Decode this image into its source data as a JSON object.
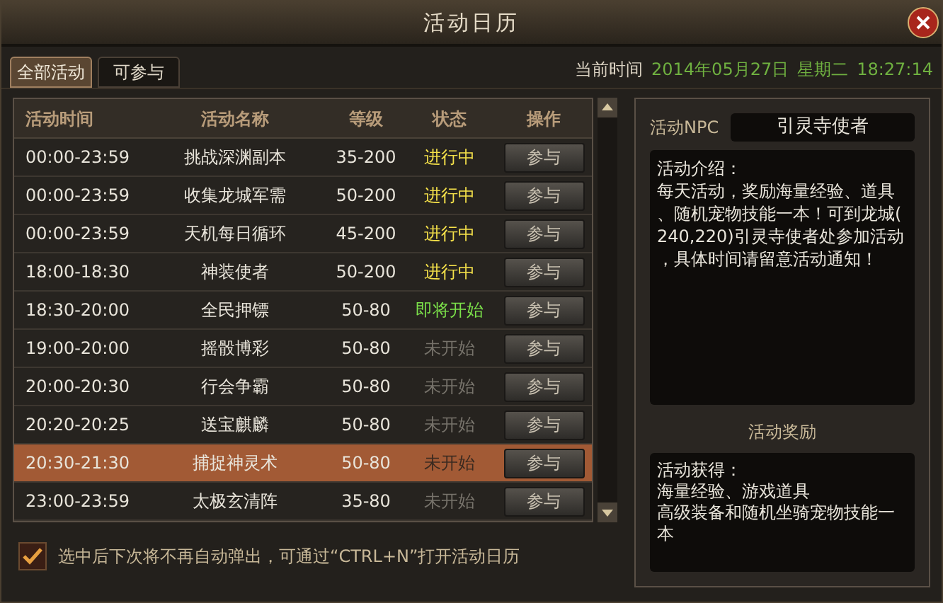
{
  "window": {
    "title": "活动日历"
  },
  "tabs": [
    {
      "label": "全部活动",
      "selected": true
    },
    {
      "label": "可参与",
      "selected": false
    }
  ],
  "current_time": {
    "label": "当前时间",
    "date": "2014年05月27日",
    "weekday": "星期二",
    "time": "18:27:14"
  },
  "table": {
    "columns": [
      "活动时间",
      "活动名称",
      "等级",
      "状态",
      "操作"
    ],
    "rows": [
      {
        "time": "00:00-23:59",
        "name": "挑战深渊副本",
        "level_range": "35-200",
        "status": "进行中",
        "kind": "running",
        "action": "参与",
        "selected": false
      },
      {
        "time": "00:00-23:59",
        "name": "收集龙城军需",
        "level_range": "50-200",
        "status": "进行中",
        "kind": "running",
        "action": "参与",
        "selected": false
      },
      {
        "time": "00:00-23:59",
        "name": "天机每日循环",
        "level_range": "45-200",
        "status": "进行中",
        "kind": "running",
        "action": "参与",
        "selected": false
      },
      {
        "time": "18:00-18:30",
        "name": "神装使者",
        "level_range": "50-200",
        "status": "进行中",
        "kind": "running",
        "action": "参与",
        "selected": false
      },
      {
        "time": "18:30-20:00",
        "name": "全民押镖",
        "level_range": "50-80",
        "status": "即将开始",
        "kind": "soon",
        "action": "参与",
        "selected": false
      },
      {
        "time": "19:00-20:00",
        "name": "摇骰博彩",
        "level_range": "50-80",
        "status": "未开始",
        "kind": "pending",
        "action": "参与",
        "selected": false
      },
      {
        "time": "20:00-20:30",
        "name": "行会争霸",
        "level_range": "50-80",
        "status": "未开始",
        "kind": "pending",
        "action": "参与",
        "selected": false
      },
      {
        "time": "20:20-20:25",
        "name": "送宝麒麟",
        "level_range": "50-80",
        "status": "未开始",
        "kind": "pending",
        "action": "参与",
        "selected": false
      },
      {
        "time": "20:30-21:30",
        "name": "捕捉神灵术",
        "level_range": "50-80",
        "status": "未开始",
        "kind": "pending",
        "action": "参与",
        "selected": true
      },
      {
        "time": "23:00-23:59",
        "name": "太极玄清阵",
        "level_range": "35-80",
        "status": "未开始",
        "kind": "pending",
        "action": "参与",
        "selected": false
      }
    ]
  },
  "details": {
    "npc_label": "活动NPC",
    "npc_name": "引灵寺使者",
    "intro_lines": [
      "活动介绍：",
      "每天活动，奖励海量经验、道具",
      "、随机宠物技能一本！可到龙城(",
      "240,220)引灵寺使者处参加活动",
      "，具体时间请留意活动通知！"
    ],
    "reward_title": "活动奖励",
    "reward_lines": [
      "活动获得：",
      "海量经验、游戏道具",
      "高级装备和随机坐骑宠物技能一",
      "本"
    ]
  },
  "footer": {
    "checked": true,
    "text": "选中后下次将不再自动弹出，可通过“CTRL+N”打开活动日历"
  }
}
